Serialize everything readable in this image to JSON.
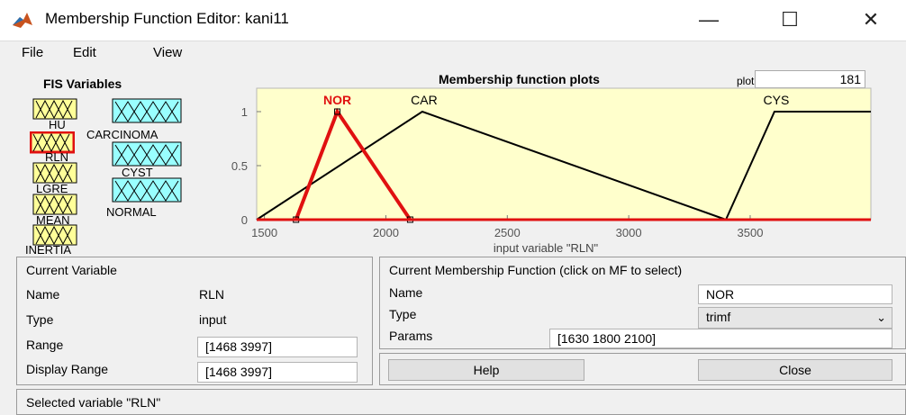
{
  "window": {
    "title": "Membership Function Editor: kani11",
    "minimize": "—",
    "maximize": "☐",
    "close": "✕"
  },
  "menu": [
    "File",
    "Edit",
    "View"
  ],
  "fis": {
    "title": "FIS Variables",
    "inputs": [
      "HU",
      "RLN",
      "LGRE",
      "MEAN",
      "INERTIA"
    ],
    "outputs": [
      "CARCINOMA",
      "CYST",
      "NORMAL"
    ],
    "selected": "RLN",
    "selected_color": "#e01010"
  },
  "plot": {
    "title": "Membership function plots",
    "plot_label": "plot",
    "plot_points": "181"
  },
  "chart_data": {
    "type": "line",
    "xlabel": "input variable \"RLN\"",
    "xlim": [
      1468,
      3997
    ],
    "ylim": [
      0,
      1
    ],
    "xticks": [
      1500,
      2000,
      2500,
      3000,
      3500
    ],
    "yticks": [
      0,
      0.5,
      1
    ],
    "background": "#ffffcc",
    "series": [
      {
        "name": "NOR",
        "x": [
          1630,
          1800,
          2100
        ],
        "y": [
          0,
          1,
          0
        ],
        "color": "#e01010",
        "selected": true
      },
      {
        "name": "CAR",
        "x": [
          1468,
          2150,
          3400
        ],
        "y": [
          0,
          1,
          0
        ],
        "color": "#000000"
      },
      {
        "name": "CYS",
        "x": [
          3400,
          3600,
          3997
        ],
        "y": [
          0,
          1,
          1
        ],
        "color": "#000000"
      }
    ]
  },
  "current_variable": {
    "header": "Current Variable",
    "name_label": "Name",
    "name": "RLN",
    "type_label": "Type",
    "type": "input",
    "range_label": "Range",
    "range": "[1468 3997]",
    "display_range_label": "Display Range",
    "display_range": "[1468 3997]"
  },
  "current_mf": {
    "header": "Current Membership Function (click on MF to select)",
    "name_label": "Name",
    "name": "NOR",
    "type_label": "Type",
    "type": "trimf",
    "params_label": "Params",
    "params": "[1630 1800 2100]"
  },
  "buttons": {
    "help": "Help",
    "close": "Close"
  },
  "status": "Selected variable \"RLN\""
}
